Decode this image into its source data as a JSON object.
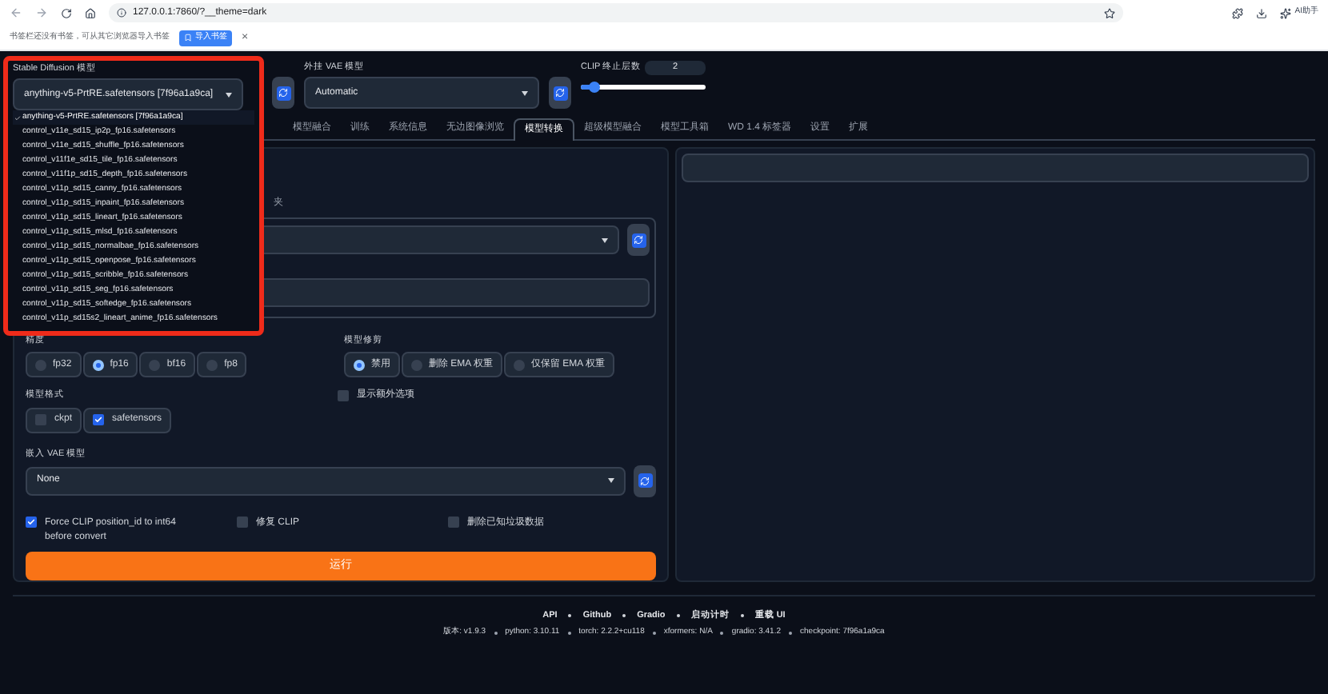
{
  "browser": {
    "url": "127.0.0.1:7860/?__theme=dark",
    "ai_label": "AI助手",
    "bookmarks_notice": "书签栏还没有书签，可从其它浏览器导入书签",
    "import_button": "导入书签",
    "close": "×"
  },
  "settings": {
    "model": {
      "label": "Stable Diffusion 模型",
      "value": "anything-v5-PrtRE.safetensors [7f96a1a9ca]",
      "expanded": true,
      "options": [
        {
          "text": "anything-v5-PrtRE.safetensors [7f96a1a9ca]",
          "selected": true
        },
        {
          "text": "control_v11e_sd15_ip2p_fp16.safetensors",
          "selected": false
        },
        {
          "text": "control_v11e_sd15_shuffle_fp16.safetensors",
          "selected": false
        },
        {
          "text": "control_v11f1e_sd15_tile_fp16.safetensors",
          "selected": false
        },
        {
          "text": "control_v11f1p_sd15_depth_fp16.safetensors",
          "selected": false
        },
        {
          "text": "control_v11p_sd15_canny_fp16.safetensors",
          "selected": false
        },
        {
          "text": "control_v11p_sd15_inpaint_fp16.safetensors",
          "selected": false
        },
        {
          "text": "control_v11p_sd15_lineart_fp16.safetensors",
          "selected": false
        },
        {
          "text": "control_v11p_sd15_mlsd_fp16.safetensors",
          "selected": false
        },
        {
          "text": "control_v11p_sd15_normalbae_fp16.safetensors",
          "selected": false
        },
        {
          "text": "control_v11p_sd15_openpose_fp16.safetensors",
          "selected": false
        },
        {
          "text": "control_v11p_sd15_scribble_fp16.safetensors",
          "selected": false
        },
        {
          "text": "control_v11p_sd15_seg_fp16.safetensors",
          "selected": false
        },
        {
          "text": "control_v11p_sd15_softedge_fp16.safetensors",
          "selected": false
        },
        {
          "text": "control_v11p_sd15s2_lineart_anime_fp16.safetensors",
          "selected": false
        }
      ]
    },
    "vae": {
      "label": "外挂 VAE 模型",
      "value": "Automatic"
    },
    "clip": {
      "label": "CLIP 终止层数",
      "value": "2",
      "level": 0.1
    }
  },
  "tabs": [
    {
      "label": "模型融合",
      "selected": false
    },
    {
      "label": "训练",
      "selected": false
    },
    {
      "label": "系统信息",
      "selected": false
    },
    {
      "label": "无边图像浏览",
      "selected": false
    },
    {
      "label": "模型转换",
      "selected": true
    },
    {
      "label": "超级模型融合",
      "selected": false
    },
    {
      "label": "模型工具箱",
      "selected": false
    },
    {
      "label": "WD 1.4 标签器",
      "selected": false
    },
    {
      "label": "设置",
      "selected": false
    },
    {
      "label": "扩展",
      "selected": false
    }
  ],
  "convert": {
    "folder_label": "夹",
    "precision": {
      "label": "精度",
      "options": [
        {
          "label": "fp32",
          "selected": false
        },
        {
          "label": "fp16",
          "selected": true
        },
        {
          "label": "bf16",
          "selected": false
        },
        {
          "label": "fp8",
          "selected": false
        }
      ]
    },
    "pruning": {
      "label": "模型修剪",
      "options": [
        {
          "label": "禁用",
          "selected": true
        },
        {
          "label": "删除 EMA 权重",
          "selected": false
        },
        {
          "label": "仅保留 EMA 权重",
          "selected": false
        }
      ]
    },
    "format": {
      "label": "模型格式",
      "options": [
        {
          "label": "ckpt",
          "checked": false
        },
        {
          "label": "safetensors",
          "checked": true
        }
      ]
    },
    "show_extra": {
      "label": "显示额外选项",
      "checked": false
    },
    "bake_vae": {
      "label": "嵌入 VAE 模型",
      "value": "None"
    },
    "flags": [
      {
        "label": "Force CLIP position_id to int64 before convert",
        "checked": true
      },
      {
        "label": "修复 CLIP",
        "checked": false
      },
      {
        "label": "删除已知垃圾数据",
        "checked": false
      }
    ],
    "run_button": "运行"
  },
  "footer": {
    "links": [
      "API",
      "Github",
      "Gradio",
      "启动计时",
      "重载 UI"
    ],
    "versions": [
      "版本: v1.9.3",
      "python: 3.10.11",
      "torch: 2.2.2+cu118",
      "xformers: N/A",
      "gradio: 3.41.2",
      "checkpoint: 7f96a1a9ca"
    ]
  }
}
